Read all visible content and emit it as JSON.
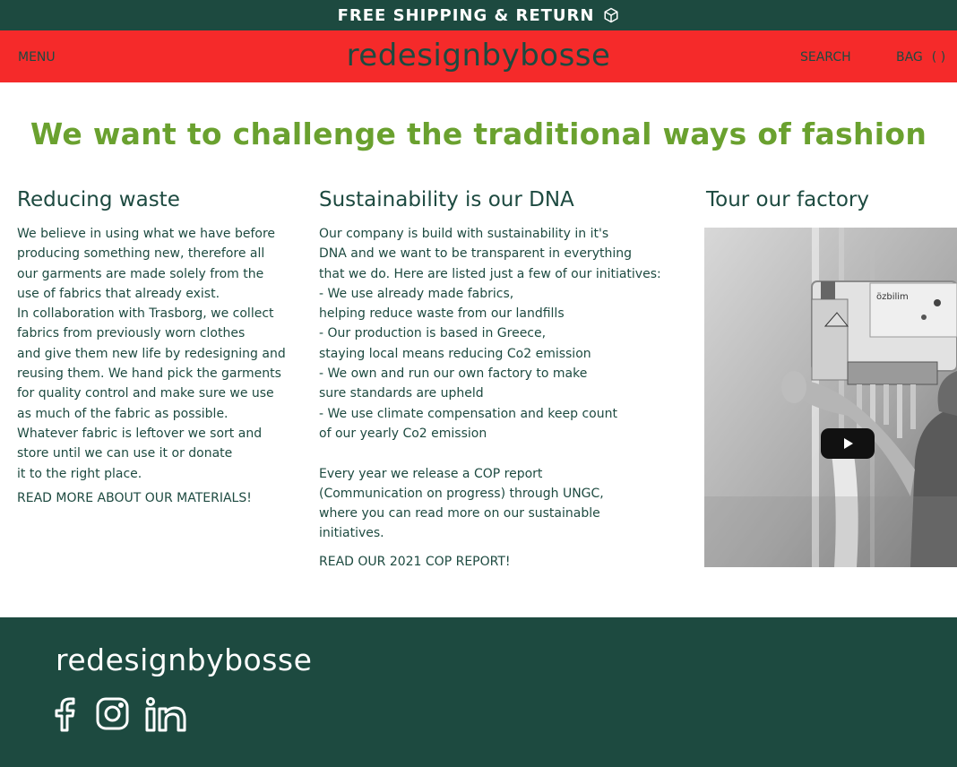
{
  "announcement": {
    "text": "FREE SHIPPING & RETURN",
    "icon": "box-icon"
  },
  "header": {
    "menu_label": "MENU",
    "logo": "redesignbybosse",
    "search_label": "SEARCH",
    "bag_label": "BAG",
    "bag_count": "( )"
  },
  "headline": "We want to challenge the traditional ways of fashion",
  "sections": [
    {
      "title": "Reducing waste",
      "lines": [
        "We believe in using what we have before",
        "producing something new, therefore all",
        "our garments are made solely from the",
        "use of fabrics that already exist.",
        "In collaboration with Trasborg, we collect",
        "fabrics from previously worn clothes",
        "and give them new life by redesigning and",
        "reusing them. We hand pick the garments",
        "for quality control and make sure we use",
        "as much of the fabric as possible.",
        "Whatever fabric is leftover we sort and",
        "store until we can use it or donate",
        "it to the right place."
      ],
      "link": "READ MORE ABOUT OUR MATERIALS!"
    },
    {
      "title": "Sustainability is our DNA",
      "lines": [
        "Our company is build with sustainability in it's",
        "DNA and we want to be transparent in everything",
        "that we do. Here are listed just a few of our initiatives:",
        "- We use already made fabrics,",
        "helping reduce waste from our landfills",
        "- Our production is based in Greece,",
        "staying local means reducing Co2 emission",
        "- We own and run our own factory to make",
        "sure standards are upheld",
        "- We use climate compensation and keep count",
        "of our yearly Co2 emission",
        "",
        "Every year we release a COP report",
        "(Communication on progress) through UNGC,",
        "where you can read more on our sustainable",
        "initiatives."
      ],
      "link": "READ OUR 2021 COP REPORT!"
    },
    {
      "title": "Tour our factory",
      "video": {
        "machine_label": "özbilim",
        "play_icon": "play-icon"
      }
    }
  ],
  "footer": {
    "logo": "redesignbybosse",
    "social": [
      "facebook-icon",
      "instagram-icon",
      "linkedin-icon"
    ]
  },
  "colors": {
    "dark_green": "#1d4a40",
    "red": "#f52a2a",
    "headline_green": "#6aa12f",
    "white": "#ffffff"
  }
}
